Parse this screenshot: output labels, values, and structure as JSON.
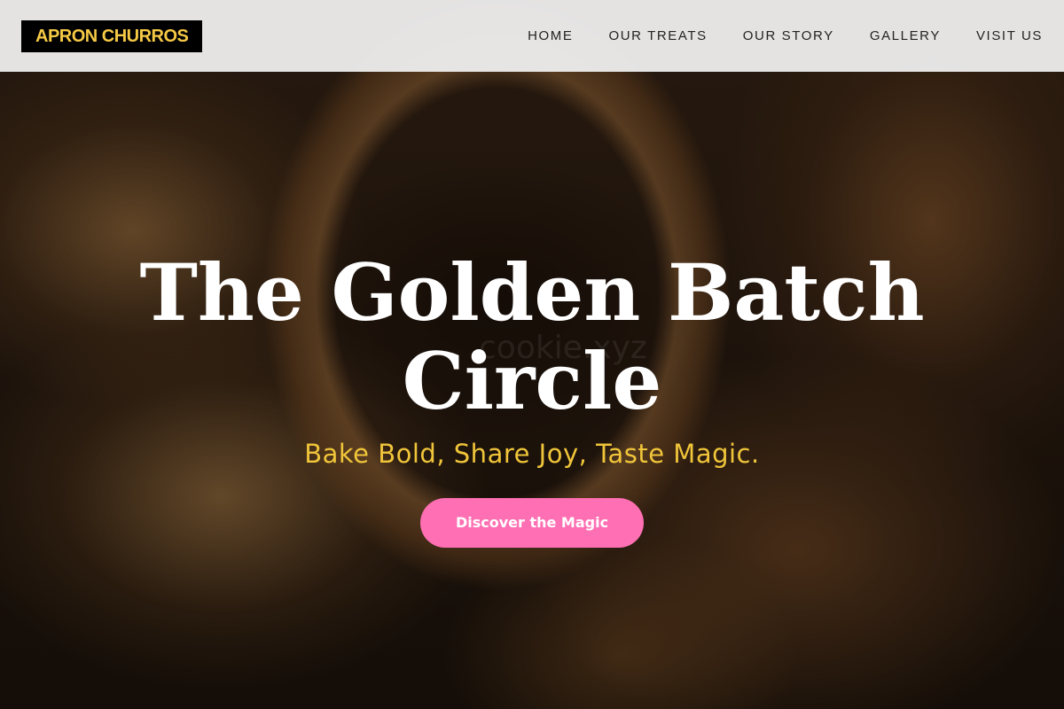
{
  "header": {
    "logo_text": "APRON CHURROS",
    "nav": [
      {
        "label": "HOME"
      },
      {
        "label": "OUR TREATS"
      },
      {
        "label": "OUR STORY"
      },
      {
        "label": "GALLERY"
      },
      {
        "label": "VISIT US"
      }
    ]
  },
  "hero": {
    "title": "The Golden Batch Circle",
    "subtitle": "Bake Bold, Share Joy, Taste Magic.",
    "cta_label": "Discover the Magic",
    "watermark": "cookie.xyz"
  },
  "colors": {
    "logo_bg": "#000000",
    "logo_text": "#f6c945",
    "subtitle": "#f0c53a",
    "cta_bg": "#ff6fb3",
    "header_bg": "#f0f0f0"
  }
}
